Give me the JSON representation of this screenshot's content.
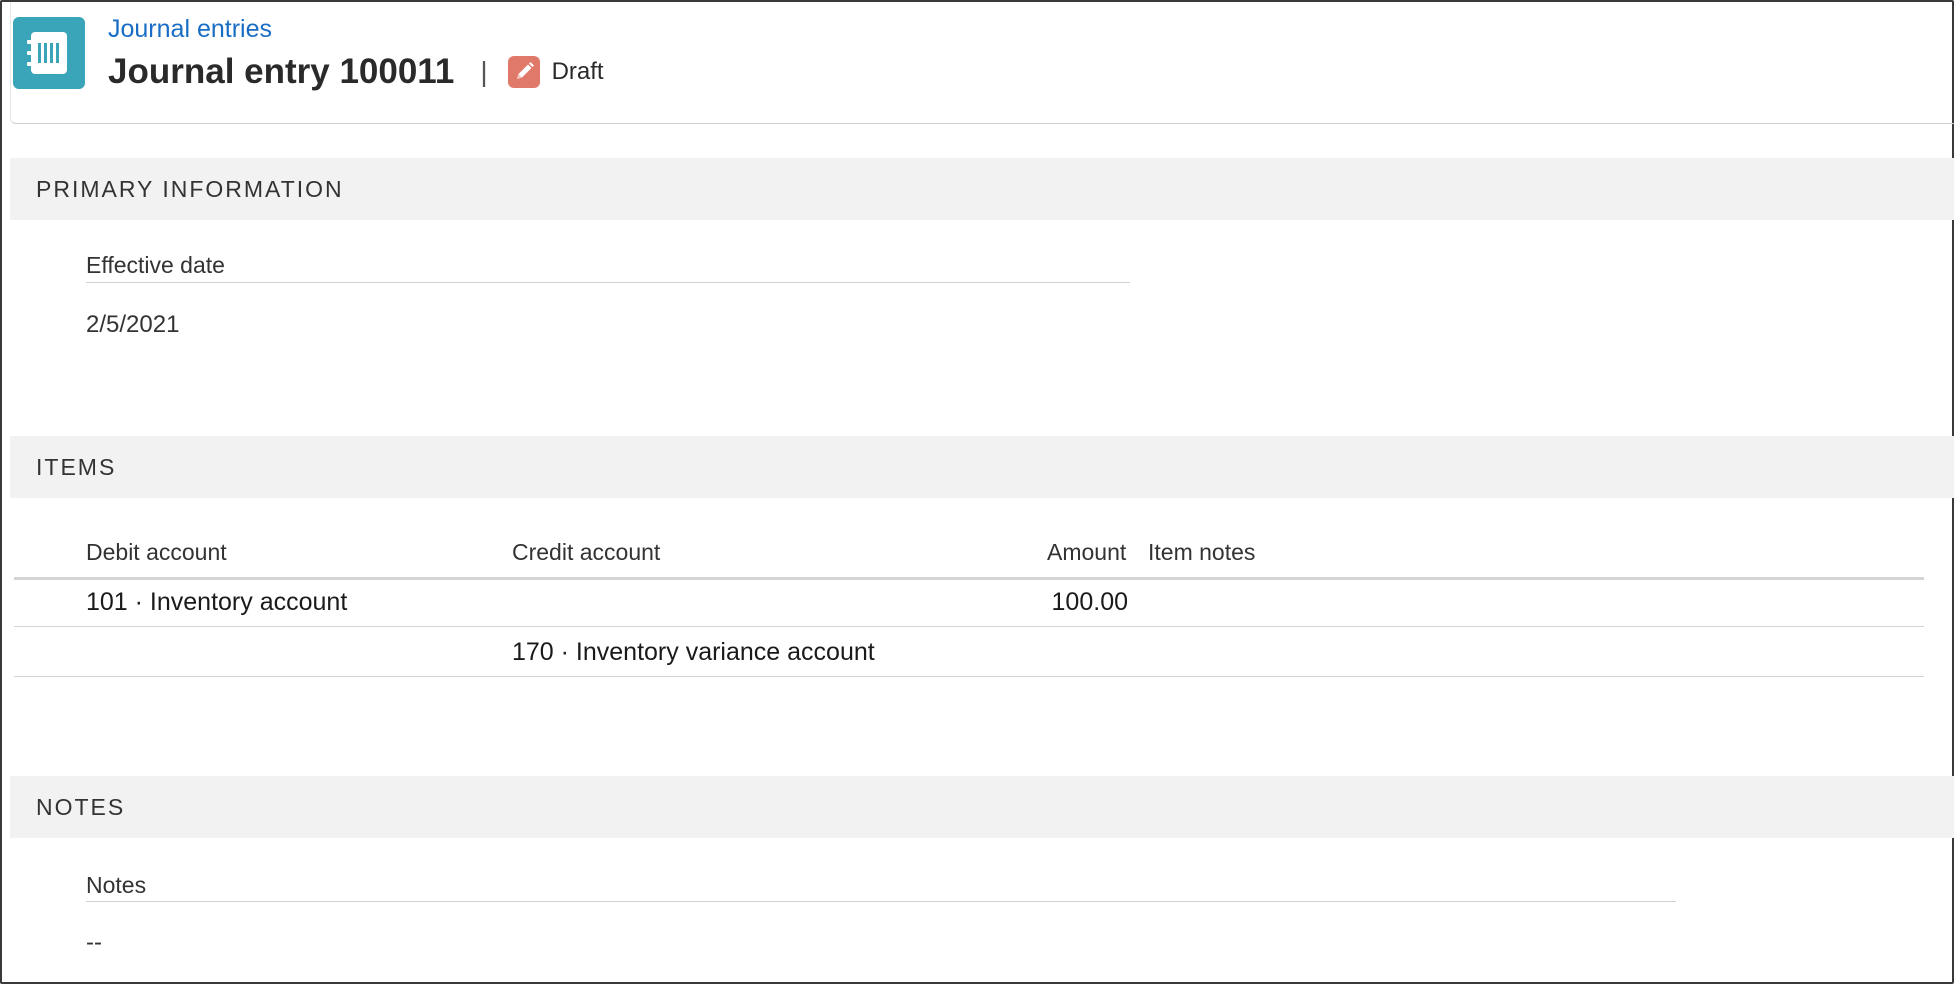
{
  "header": {
    "breadcrumb": "Journal entries",
    "title": "Journal entry 100011",
    "separator": "|",
    "status": "Draft",
    "app_icon": "journal-icon",
    "status_icon": "pencil-icon",
    "accent": "#3aa4b8",
    "status_color": "#e0796a"
  },
  "primary_information": {
    "heading": "PRIMARY INFORMATION",
    "effective_date_label": "Effective date",
    "effective_date_value": "2/5/2021"
  },
  "items": {
    "heading": "ITEMS",
    "columns": {
      "debit_account": "Debit account",
      "credit_account": "Credit account",
      "amount": "Amount",
      "item_notes": "Item notes"
    },
    "rows": [
      {
        "debit_account": "101 · Inventory account",
        "credit_account": "",
        "amount": "100.00",
        "item_notes": ""
      },
      {
        "debit_account": "",
        "credit_account": "170 · Inventory variance account",
        "amount": "",
        "item_notes": ""
      }
    ]
  },
  "notes": {
    "heading": "NOTES",
    "notes_label": "Notes",
    "notes_value": "--"
  }
}
